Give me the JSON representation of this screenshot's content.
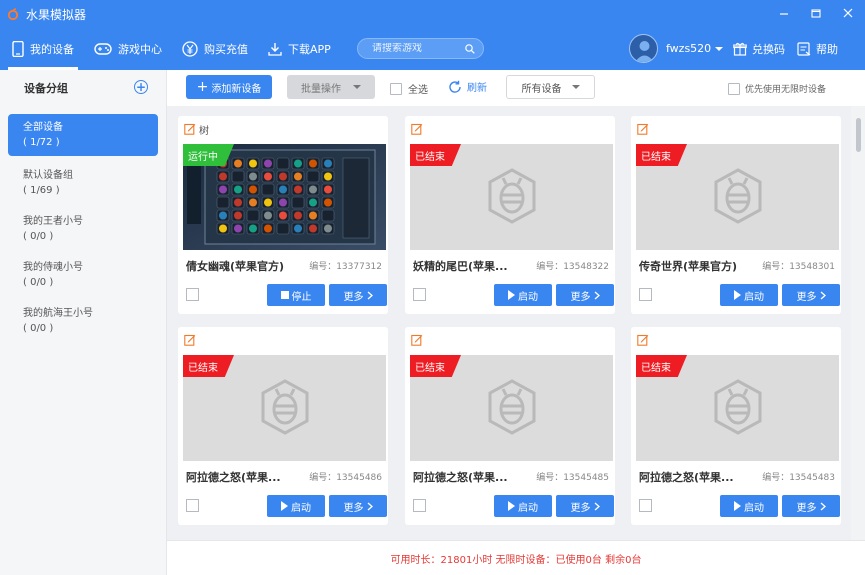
{
  "app": {
    "title": "水果模拟器"
  },
  "nav": {
    "items": [
      {
        "label": "我的设备",
        "icon": "phone-icon"
      },
      {
        "label": "游戏中心",
        "icon": "gamepad-icon"
      },
      {
        "label": "购买充值",
        "icon": "yuan-icon"
      },
      {
        "label": "下载APP",
        "icon": "download-icon"
      }
    ],
    "search_placeholder": "请搜索游戏",
    "username": "fwzs520",
    "redeem": "兑换码",
    "help": "帮助"
  },
  "sidebar": {
    "header": "设备分组",
    "groups": [
      {
        "name": "全部设备",
        "count": "( 1/72 )"
      },
      {
        "name": "默认设备组",
        "count": "( 1/69 )"
      },
      {
        "name": "我的王者小号",
        "count": "( 0/0 )"
      },
      {
        "name": "我的侍魂小号",
        "count": "( 0/0 )"
      },
      {
        "name": "我的航海王小号",
        "count": "( 0/0 )"
      }
    ]
  },
  "toolbar": {
    "add_device": "添加新设备",
    "batch": "批量操作",
    "select_all": "全选",
    "refresh": "刷新",
    "all_devices": "所有设备",
    "prefer_unlimited": "优先使用无限时设备"
  },
  "cards": [
    {
      "nickname": "树",
      "status": "运行中",
      "game": "倩女幽魂(苹果官方)",
      "id": "编号：13377312",
      "action": "停止",
      "more": "更多"
    },
    {
      "nickname": "",
      "status": "已结束",
      "game": "妖精的尾巴(苹果...",
      "id": "编号：13548322",
      "action": "启动",
      "more": "更多"
    },
    {
      "nickname": "",
      "status": "已结束",
      "game": "传奇世界(苹果官方)",
      "id": "编号：13548301",
      "action": "启动",
      "more": "更多"
    },
    {
      "nickname": "",
      "status": "已结束",
      "game": "阿拉德之怒(苹果...",
      "id": "编号：13545486",
      "action": "启动",
      "more": "更多"
    },
    {
      "nickname": "",
      "status": "已结束",
      "game": "阿拉德之怒(苹果...",
      "id": "编号：13545485",
      "action": "启动",
      "more": "更多"
    },
    {
      "nickname": "",
      "status": "已结束",
      "game": "阿拉德之怒(苹果...",
      "id": "编号：13545483",
      "action": "启动",
      "more": "更多"
    }
  ],
  "footer": {
    "text": "可用时长：21801小时 无限时设备：已使用0台 剩余0台"
  },
  "colors": {
    "primary": "#3a86f0",
    "stopped": "#ee1d23",
    "running": "#2fbf3b",
    "footer_text": "#e53935"
  }
}
